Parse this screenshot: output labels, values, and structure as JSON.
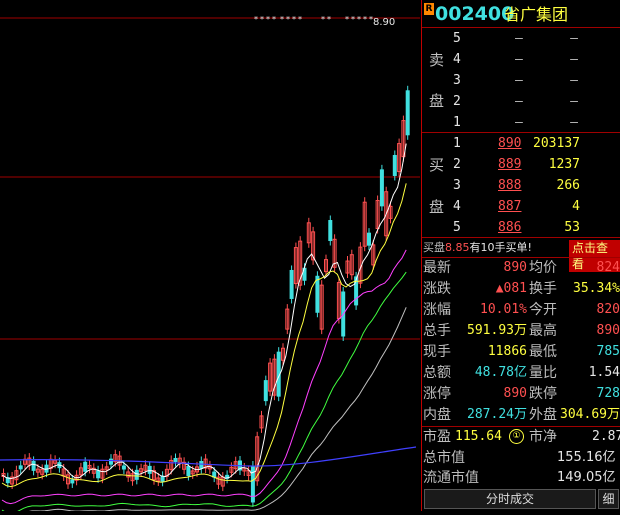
{
  "stock": {
    "badge": "R",
    "code": "002400",
    "name": "省广集团"
  },
  "chart": {
    "top_marker": "8.90"
  },
  "sell": {
    "side_top": "卖",
    "side_bottom": "盘",
    "rows": [
      {
        "level": "5",
        "price": "–",
        "vol": "–"
      },
      {
        "level": "4",
        "price": "–",
        "vol": "–"
      },
      {
        "level": "3",
        "price": "–",
        "vol": "–"
      },
      {
        "level": "2",
        "price": "–",
        "vol": "–"
      },
      {
        "level": "1",
        "price": "–",
        "vol": "–"
      }
    ]
  },
  "buy": {
    "side_top": "买",
    "side_bottom": "盘",
    "rows": [
      {
        "level": "1",
        "price": "890",
        "vol": "203137"
      },
      {
        "level": "2",
        "price": "889",
        "vol": "1237"
      },
      {
        "level": "3",
        "price": "888",
        "vol": "266"
      },
      {
        "level": "4",
        "price": "887",
        "vol": "4"
      },
      {
        "level": "5",
        "price": "886",
        "vol": "53"
      }
    ]
  },
  "notice": {
    "prefix": "买盘",
    "price": "8.85",
    "suffix": "有10手买单!",
    "button": "点击查看"
  },
  "stats": [
    {
      "l1": "最新",
      "v1": "890",
      "c1": "red",
      "l2": "均价",
      "v2": "824",
      "c2": "red"
    },
    {
      "l1": "涨跌",
      "v1": "▲081",
      "c1": "red",
      "l2": "换手",
      "v2": "35.34%",
      "c2": "yellow"
    },
    {
      "l1": "涨幅",
      "v1": "10.01%",
      "c1": "red",
      "l2": "今开",
      "v2": "820",
      "c2": "red"
    },
    {
      "l1": "总手",
      "v1": "591.93万",
      "c1": "yellow",
      "l2": "最高",
      "v2": "890",
      "c2": "red"
    },
    {
      "l1": "现手",
      "v1": "11866",
      "c1": "yellow",
      "l2": "最低",
      "v2": "785",
      "c2": "cyan"
    },
    {
      "l1": "总额",
      "v1": "48.78亿",
      "c1": "cyan",
      "l2": "量比",
      "v2": "1.54",
      "c2": "white"
    },
    {
      "l1": "涨停",
      "v1": "890",
      "c1": "red",
      "l2": "跌停",
      "v2": "728",
      "c2": "cyan"
    },
    {
      "l1": "内盘",
      "v1": "287.24万",
      "c1": "cyan",
      "l2": "外盘",
      "v2": "304.69万",
      "c2": "yellow"
    }
  ],
  "valuation": {
    "pe_label": "市盈",
    "pe_value": "115.64",
    "pe_icon": "①",
    "pb_label": "市净",
    "pb_value": "2.87",
    "total_label": "总市值",
    "total_value": "155.16亿",
    "float_label": "流通市值",
    "float_value": "149.05亿"
  },
  "tabs": {
    "main": "分时成交",
    "detail": "细"
  },
  "colors": {
    "up": "#ff5050",
    "down": "#40e0e0",
    "ma5": "#ffffff",
    "ma10": "#ffff40",
    "ma20": "#ff40ff",
    "ma30": "#40ff40",
    "ma60": "#c0c0c0",
    "ma120": "#4040ff",
    "grid": "#a00000"
  }
}
